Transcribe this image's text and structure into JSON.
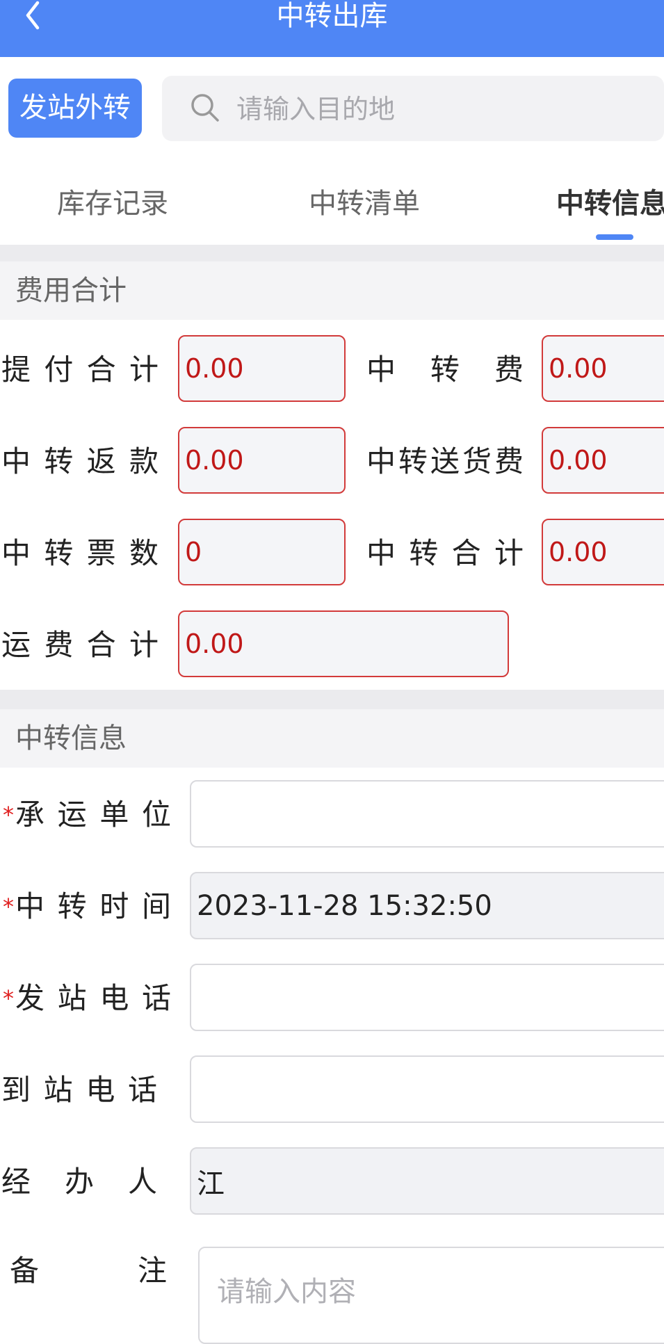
{
  "header": {
    "title": "中转出库",
    "back_icon": "chevron-left-icon"
  },
  "toolbar": {
    "external_button": "发站外转",
    "search_icon": "search-icon",
    "search_placeholder": "请输入目的地"
  },
  "tabs": [
    {
      "label": "库存记录",
      "active": false
    },
    {
      "label": "中转清单",
      "active": false
    },
    {
      "label": "中转信息",
      "active": true
    }
  ],
  "fees": {
    "section_title": "费用合计",
    "rows": [
      {
        "label": "提付合计",
        "value": "0.00"
      },
      {
        "label": "中转费",
        "value": "0.00"
      },
      {
        "label": "中转返款",
        "value": "0.00"
      },
      {
        "label": "中转送货费",
        "value": "0.00"
      },
      {
        "label": "中转票数",
        "value": "0"
      },
      {
        "label": "中转合计",
        "value": "0.00"
      },
      {
        "label": "运费合计",
        "value": "0.00"
      }
    ]
  },
  "info": {
    "section_title": "中转信息",
    "required_mark": "*",
    "fields": [
      {
        "label": "承运单位",
        "value": "",
        "required": true
      },
      {
        "label": "中转时间",
        "value": "2023-11-28 15:32:50",
        "required": true
      },
      {
        "label": "发站电话",
        "value": "",
        "required": true
      },
      {
        "label": "到站电话",
        "value": "",
        "required": false
      },
      {
        "label": "经办人",
        "value": "江",
        "required": false
      }
    ],
    "remark": {
      "label": "备注",
      "placeholder": "请输入内容"
    }
  },
  "colors": {
    "primary": "#4f86f5",
    "error": "#d23a3a",
    "value_text": "#c01818"
  }
}
